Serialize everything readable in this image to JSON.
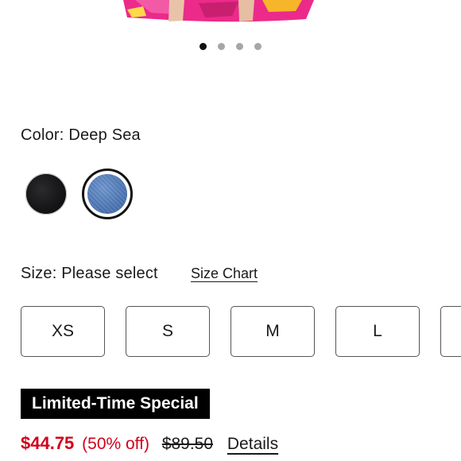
{
  "carousel": {
    "active_index": 0,
    "count": 4
  },
  "color": {
    "label": "Color:",
    "selected": "Deep Sea",
    "swatches": [
      {
        "name": "Black",
        "hex": "#141416",
        "selected": false
      },
      {
        "name": "Deep Sea",
        "hex": "#4f78b6",
        "selected": true
      }
    ]
  },
  "size": {
    "label": "Size:",
    "selected_text": "Please select",
    "chart_link": "Size Chart",
    "options": [
      "XS",
      "S",
      "M",
      "L",
      ""
    ]
  },
  "promo": {
    "label": "Limited-Time Special"
  },
  "price": {
    "sale": "$44.75",
    "discount": "(50% off)",
    "original": "$89.50",
    "details_link": "Details",
    "sale_color": "#d0021b"
  }
}
